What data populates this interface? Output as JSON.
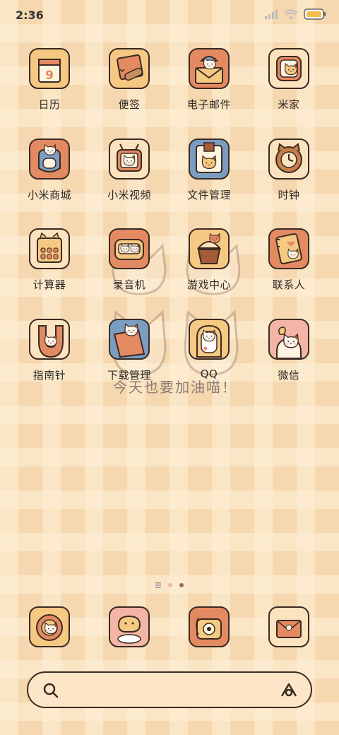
{
  "status": {
    "time": "2:36",
    "battery_icon": "battery-icon",
    "wifi_icon": "wifi-icon",
    "signal_icon": "signal-icon"
  },
  "apps": [
    {
      "label": "日历",
      "icon": "calendar-icon",
      "day": "9",
      "bg": "#f6c982"
    },
    {
      "label": "便签",
      "icon": "notes-icon",
      "bg": "#f6c982"
    },
    {
      "label": "电子邮件",
      "icon": "email-icon",
      "bg": "#e48a62"
    },
    {
      "label": "米家",
      "icon": "mijia-icon",
      "bg": "#fbe3c0"
    },
    {
      "label": "小米商城",
      "icon": "mi-store-icon",
      "bg": "#e48a62"
    },
    {
      "label": "小米视频",
      "icon": "mi-video-icon",
      "bg": "#fbe3c0"
    },
    {
      "label": "文件管理",
      "icon": "file-manager-icon",
      "bg": "#7b9dc0"
    },
    {
      "label": "时钟",
      "icon": "clock-icon",
      "bg": "#fbe3c0"
    },
    {
      "label": "计算器",
      "icon": "calculator-icon",
      "bg": "#fbe3c0"
    },
    {
      "label": "录音机",
      "icon": "recorder-icon",
      "bg": "#e48a62"
    },
    {
      "label": "游戏中心",
      "icon": "game-center-icon",
      "bg": "#f6c982"
    },
    {
      "label": "联系人",
      "icon": "contacts-icon",
      "bg": "#e48a62"
    },
    {
      "label": "指南针",
      "icon": "compass-icon",
      "bg": "#fbe3c0"
    },
    {
      "label": "下载管理",
      "icon": "download-manager-icon",
      "bg": "#7b9dc0"
    },
    {
      "label": "QQ",
      "icon": "qq-icon",
      "bg": "#f6c982"
    },
    {
      "label": "微信",
      "icon": "wechat-icon",
      "bg": "#f2b5a6"
    }
  ],
  "widget": {
    "text": "今天也要加油喵！"
  },
  "dock": [
    {
      "icon": "phone-icon",
      "bg": "#f6c982"
    },
    {
      "icon": "messages-icon",
      "bg": "#f2b5a6"
    },
    {
      "icon": "camera-icon",
      "bg": "#e48a62"
    },
    {
      "icon": "browser-icon",
      "bg": "#fbe3c0"
    }
  ],
  "search": {
    "search_icon": "search-icon",
    "assistant_icon": "assistant-icon"
  },
  "colors": {
    "outline": "#3b2a22",
    "cat_white": "#fff7ec",
    "cat_brown": "#8a5a3e",
    "accent": "#e48a62"
  }
}
